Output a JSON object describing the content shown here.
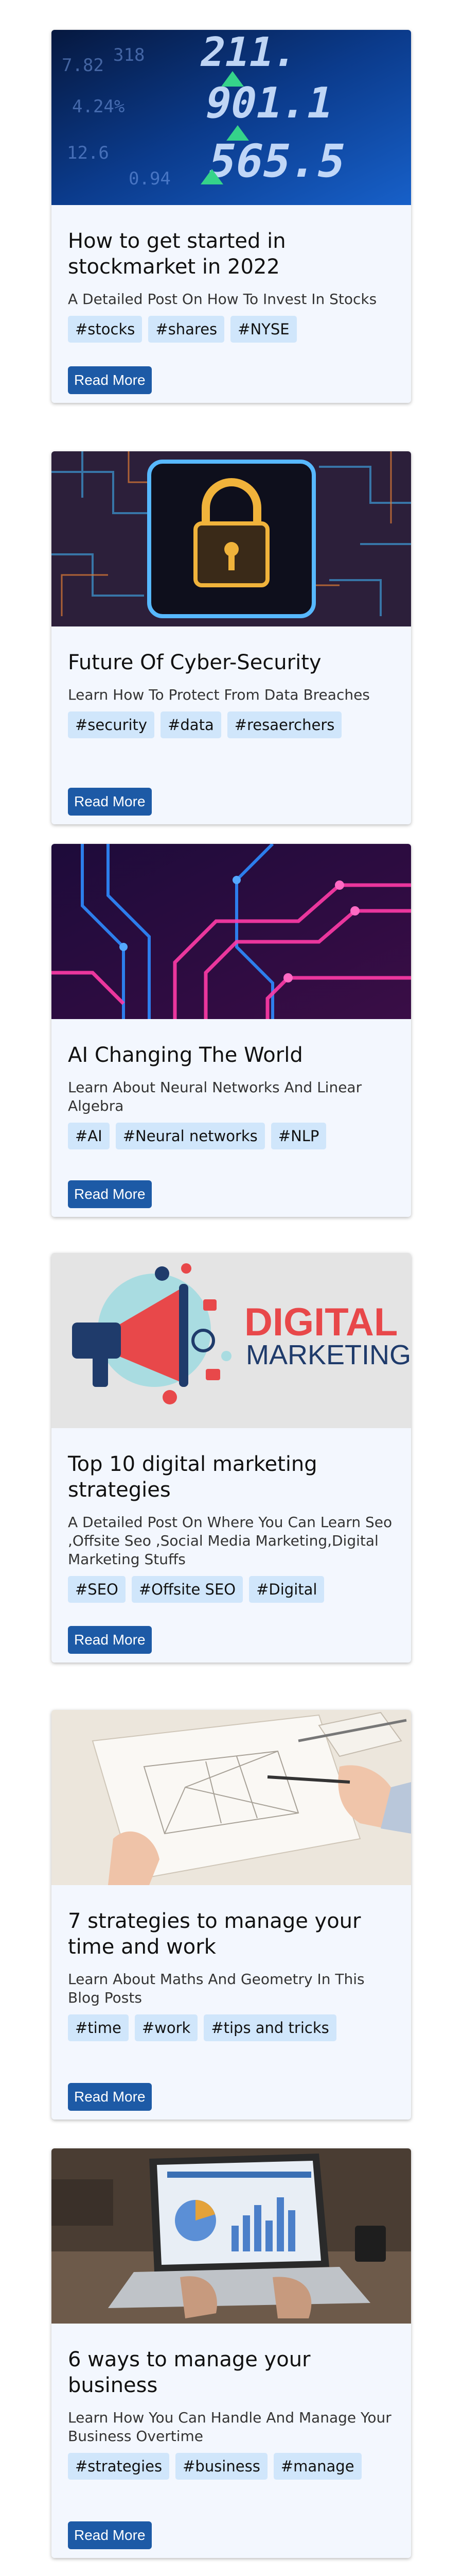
{
  "posts": [
    {
      "title": "How to get started in stockmarket in 2022",
      "subtitle": "A Detailed Post On How To Invest In Stocks",
      "tags": [
        "#stocks",
        "#shares",
        "#NYSE"
      ],
      "button": "Read More",
      "image_alt": "stock ticker board"
    },
    {
      "title": "Future Of Cyber-Security",
      "subtitle": "Learn How To Protect From Data Breaches",
      "tags": [
        "#security",
        "#data",
        "#resaerchers"
      ],
      "button": "Read More",
      "image_alt": "glowing padlock on circuit board"
    },
    {
      "title": "AI Changing The World",
      "subtitle": "Learn About Neural Networks And Linear Algebra",
      "tags": [
        "#AI",
        "#Neural networks",
        "#NLP"
      ],
      "button": "Read More",
      "image_alt": "neon circuit traces"
    },
    {
      "title": "Top 10 digital marketing strategies",
      "subtitle": "A Detailed Post On Where You Can Learn Seo ,Offsite Seo ,Social Media Marketing,Digital Marketing Stuffs",
      "tags": [
        "#SEO",
        "#Offsite SEO",
        "#Digital"
      ],
      "button": "Read More",
      "image_alt": "digital marketing megaphone illustration",
      "image_text": [
        "DIGITAL",
        "MARKETING"
      ]
    },
    {
      "title": "7 strategies to manage your time and work",
      "subtitle": "Learn About Maths And Geometry In This Blog Posts",
      "tags": [
        "#time",
        "#work",
        "#tips and tricks"
      ],
      "button": "Read More",
      "image_alt": "hands drawing sketches on desk"
    },
    {
      "title": "6 ways to manage your business",
      "subtitle": "Learn How You Can Handle And Manage Your Business Overtime",
      "tags": [
        "#strategies",
        "#business",
        "#manage"
      ],
      "button": "Read More",
      "image_alt": "laptop with business charts"
    }
  ],
  "colors": {
    "card_bg": "#f3f7fe",
    "tag_bg": "#d0e6fb",
    "button_bg": "#1d5aa6",
    "marketing_red": "#e8484a",
    "marketing_navy": "#1f3b6b"
  }
}
